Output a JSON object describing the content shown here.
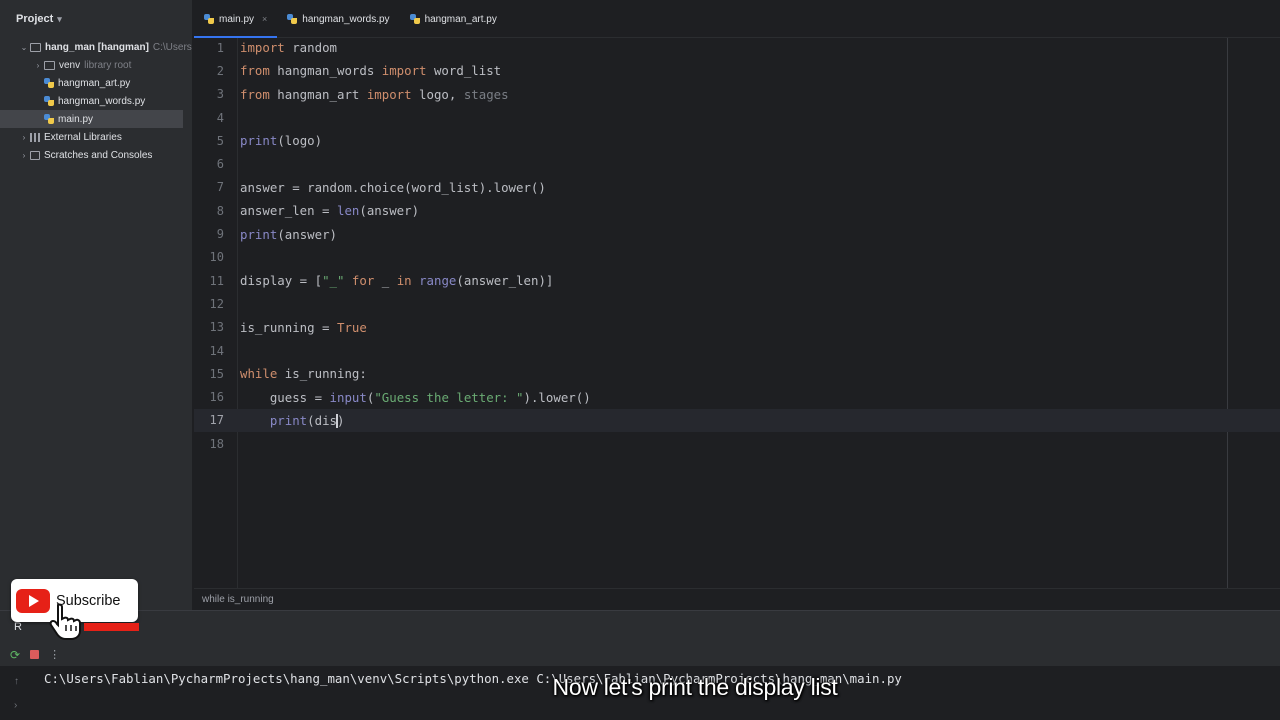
{
  "project_panel": {
    "title": "Project",
    "tree": [
      {
        "label": "hang_man [hangman]",
        "suffix": "C:\\Users",
        "kind": "folder",
        "depth": 0,
        "expanded": true
      },
      {
        "label": "venv",
        "suffix": "library root",
        "kind": "folder",
        "depth": 1,
        "expanded": false
      },
      {
        "label": "hangman_art.py",
        "kind": "py",
        "depth": 1
      },
      {
        "label": "hangman_words.py",
        "kind": "py",
        "depth": 1
      },
      {
        "label": "main.py",
        "kind": "py",
        "depth": 1,
        "selected": true
      },
      {
        "label": "External Libraries",
        "kind": "lib",
        "depth": 0,
        "expanded": false
      },
      {
        "label": "Scratches and Consoles",
        "kind": "scratch",
        "depth": 0,
        "expanded": false
      }
    ]
  },
  "tabs": [
    {
      "label": "main.py",
      "active": true,
      "closable": true
    },
    {
      "label": "hangman_words.py",
      "active": false
    },
    {
      "label": "hangman_art.py",
      "active": false
    }
  ],
  "editor": {
    "current_line": 17,
    "lines": [
      [
        {
          "t": "import",
          "c": "kw"
        },
        {
          "t": " random"
        }
      ],
      [
        {
          "t": "from",
          "c": "kw"
        },
        {
          "t": " hangman_words "
        },
        {
          "t": "import",
          "c": "kw"
        },
        {
          "t": " word_list"
        }
      ],
      [
        {
          "t": "from",
          "c": "kw"
        },
        {
          "t": " hangman_art "
        },
        {
          "t": "import",
          "c": "kw"
        },
        {
          "t": " logo, "
        },
        {
          "t": "stages",
          "c": "gray"
        }
      ],
      [],
      [
        {
          "t": "print",
          "c": "bi"
        },
        {
          "t": "(logo)"
        }
      ],
      [],
      [
        {
          "t": "answer = random.choice(word_list).lower()"
        }
      ],
      [
        {
          "t": "answer_len = "
        },
        {
          "t": "len",
          "c": "bi"
        },
        {
          "t": "(answer)"
        }
      ],
      [
        {
          "t": "print",
          "c": "bi"
        },
        {
          "t": "(answer)"
        }
      ],
      [],
      [
        {
          "t": "display = ["
        },
        {
          "t": "\"_\"",
          "c": "str"
        },
        {
          "t": " "
        },
        {
          "t": "for",
          "c": "kw"
        },
        {
          "t": " _ "
        },
        {
          "t": "in",
          "c": "kw"
        },
        {
          "t": " "
        },
        {
          "t": "range",
          "c": "bi"
        },
        {
          "t": "(answer_len)]"
        }
      ],
      [],
      [
        {
          "t": "is_running = "
        },
        {
          "t": "True",
          "c": "kw"
        }
      ],
      [],
      [
        {
          "t": "while",
          "c": "kw"
        },
        {
          "t": " is_running:"
        }
      ],
      [
        {
          "t": "    guess = "
        },
        {
          "t": "input",
          "c": "bi"
        },
        {
          "t": "("
        },
        {
          "t": "\"Guess the letter: \"",
          "c": "str"
        },
        {
          "t": ").lower()"
        }
      ],
      [
        {
          "t": "    "
        },
        {
          "t": "print",
          "c": "bi"
        },
        {
          "t": "(dis"
        },
        {
          "t": "|",
          "c": "caret"
        },
        {
          "t": ")"
        }
      ],
      []
    ]
  },
  "breadcrumb": "while is_running",
  "run_panel": {
    "header": "R",
    "console_line": "C:\\Users\\Fablian\\PycharmProjects\\hang_man\\venv\\Scripts\\python.exe C:\\Users\\Fablian\\PycharmProjects\\hang_man\\main.py"
  },
  "overlay": {
    "subscribe_label": "Subscribe",
    "caption": "Now let's print the display list"
  },
  "colors": {
    "accent": "#3574f0",
    "youtube_red": "#e62117"
  }
}
